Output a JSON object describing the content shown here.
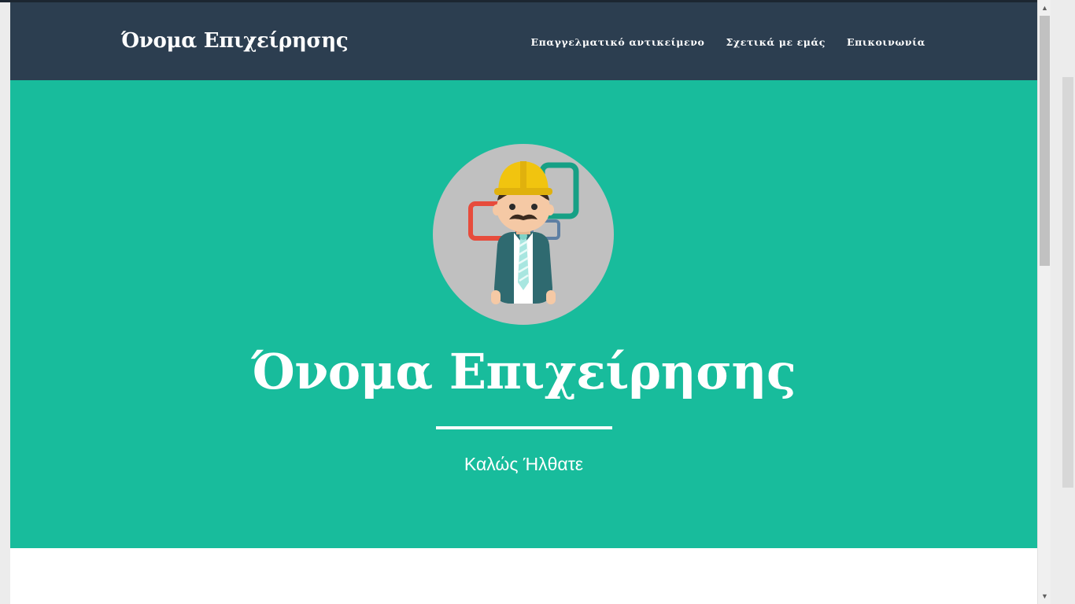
{
  "navbar": {
    "brand": "Όνομα Επιχείρησης",
    "links": [
      {
        "label": "Επαγγελματικό αντικείμενο"
      },
      {
        "label": "Σχετικά με εμάς"
      },
      {
        "label": "Επικοινωνία"
      }
    ],
    "background": "#2c3e50"
  },
  "hero": {
    "title": "Όνομα Επιχείρησης",
    "subtitle": "Καλώς Ήλθατε",
    "background": "#18bc9c",
    "avatar_icon": "construction-worker-icon"
  },
  "scrollbar": {
    "up_icon": "▲",
    "down_icon": "▼"
  }
}
